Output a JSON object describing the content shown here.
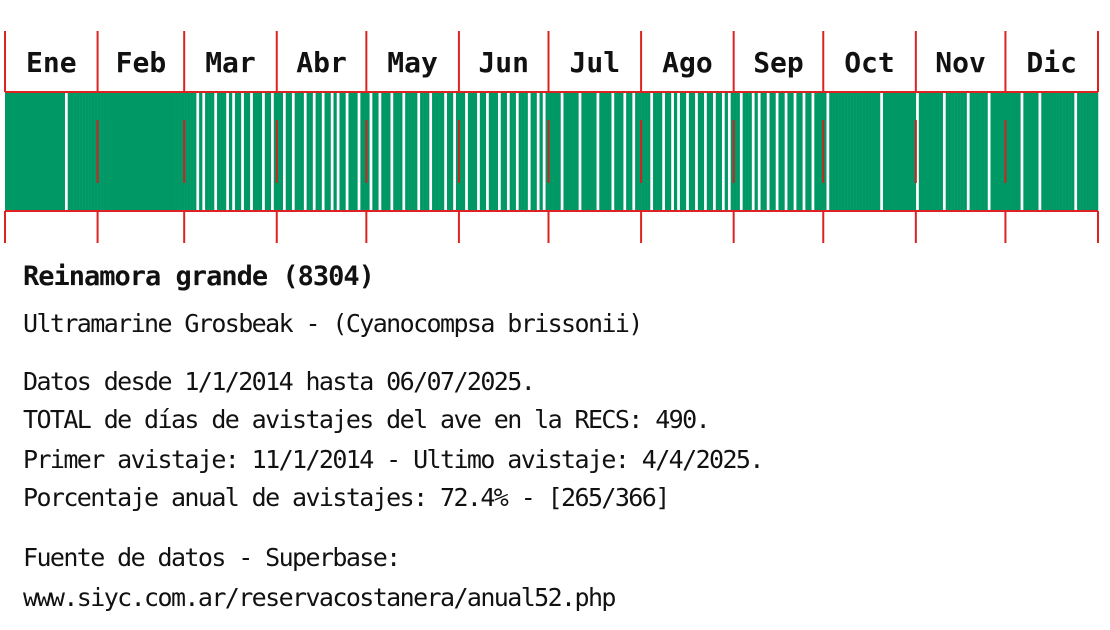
{
  "chart_data": {
    "type": "bar",
    "title": "Reinamora grande (8304)",
    "subtitle": "Ultramarine Grosbeak - (Cyanocompsa brissonii)",
    "categories": [
      "Ene",
      "Feb",
      "Mar",
      "Abr",
      "May",
      "Jun",
      "Jul",
      "Ago",
      "Sep",
      "Oct",
      "Nov",
      "Dic"
    ],
    "days_in_month": [
      31,
      29,
      31,
      30,
      31,
      30,
      31,
      31,
      30,
      31,
      30,
      31
    ],
    "days_without_sightings": [
      [
        21
      ],
      [],
      [
        5,
        7,
        11,
        15,
        17,
        20,
        23,
        27,
        30
      ],
      [
        3,
        6,
        10,
        13,
        16,
        19,
        21,
        24,
        28
      ],
      [
        2,
        5,
        9,
        13,
        18,
        22,
        27,
        30
      ],
      [
        3,
        7,
        10,
        14,
        17,
        20,
        24,
        27,
        29
      ],
      [
        5,
        11,
        17,
        22,
        26,
        29
      ],
      [
        4,
        8,
        11,
        13,
        16,
        19,
        22,
        25,
        28,
        30
      ],
      [
        3,
        7,
        9,
        12,
        15,
        18,
        21,
        24,
        27
      ],
      [
        2,
        20
      ],
      [
        1,
        10,
        18,
        25
      ],
      [
        6,
        12,
        24
      ]
    ],
    "total_days": 366,
    "days_with_sightings": 265,
    "annual_percentage": 72.4,
    "ylim": [
      0,
      1
    ],
    "colors": {
      "sighting": "#009966",
      "no_sighting": "#ffffff",
      "grid": "#dd2222",
      "text": "#111111"
    }
  },
  "info": {
    "title": "Reinamora grande (8304)",
    "subtitle": "Ultramarine Grosbeak - (Cyanocompsa brissonii)",
    "line1": "Datos desde 1/1/2014 hasta 06/07/2025.",
    "line2": "TOTAL de días de avistajes del ave en la RECS: 490.",
    "line3": "Primer avistaje: 11/1/2014 - Ultimo avistaje: 4/4/2025.",
    "line4": "Porcentaje anual de avistajes: 72.4% - [265/366]",
    "source_label": "Fuente de datos - Superbase:",
    "source_url": "www.siyc.com.ar/reservacostanera/anual52.php"
  }
}
